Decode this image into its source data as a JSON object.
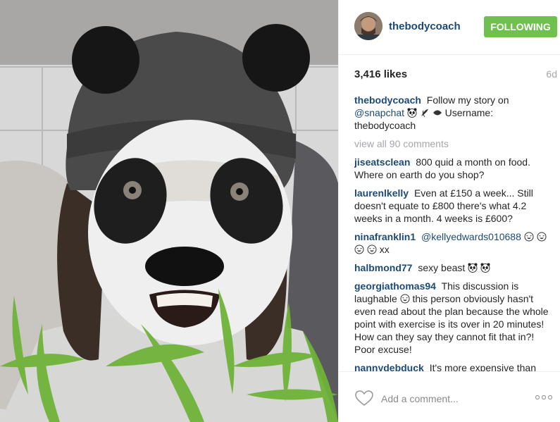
{
  "post": {
    "username": "thebodycoach",
    "follow_label": "FOLLOWING",
    "likes": "3,416 likes",
    "age": "6d",
    "accent_color": "#70c050",
    "link_color": "#1c4a75"
  },
  "caption": {
    "user": "thebodycoach",
    "text_before": "Follow my story on",
    "mention": "@snapchat",
    "text_after": "Username: thebodycoach"
  },
  "view_all": "view all 90 comments",
  "comments": [
    {
      "user": "jiseatsclean",
      "text": "800 quid a month on food. Where on earth do you shop?"
    },
    {
      "user": "laurenlkelly",
      "text": "Even at £150 a week... Still doesn't equate to £800 there's what 4.2 weeks in a month. 4 weeks is £600?"
    },
    {
      "user": "ninafranklin1",
      "mention": "@kellyedwards010688",
      "text": "xx"
    },
    {
      "user": "halbmond77",
      "text": "sexy beast"
    },
    {
      "user": "georgiathomas94",
      "text_before": "This discussion is laughable",
      "text_after": "this person obviously hasn't even read about the plan because the whole point with exercise is its over in 20 minutes! How can they say they cannot fit that in?! Poor excuse!"
    },
    {
      "user": "nannydebduck",
      "text": "It's more expensive than"
    }
  ],
  "footer": {
    "placeholder": "Add a comment...",
    "heart_icon": "heart-outline-icon",
    "more_icon": "more-options-icon"
  }
}
